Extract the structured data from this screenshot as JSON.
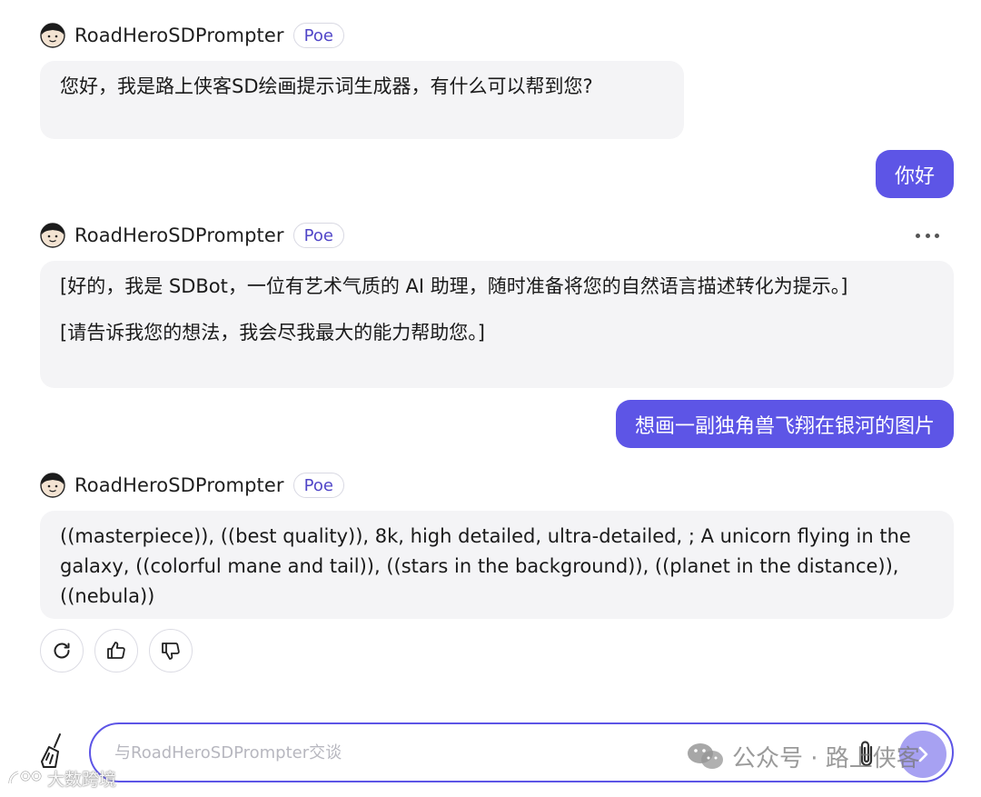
{
  "bot": {
    "name": "RoadHeroSDPrompter",
    "badge": "Poe"
  },
  "messages": {
    "m1": {
      "text": "您好，我是路上侠客SD绘画提示词生成器，有什么可以帮到您?"
    },
    "u1": {
      "text": "你好"
    },
    "m2": {
      "p1": "[好的，我是 SDBot，一位有艺术气质的 AI 助理，随时准备将您的自然语言描述转化为提示。]",
      "p2": "[请告诉我您的想法，我会尽我最大的能力帮助您。]"
    },
    "u2": {
      "text": "想画一副独角兽飞翔在银河的图片"
    },
    "m3": {
      "text": "((masterpiece)), ((best quality)), 8k, high detailed, ultra-detailed, ; A unicorn flying in the galaxy, ((colorful mane and tail)), ((stars in the background)), ((planet in the distance)), ((nebula))"
    }
  },
  "composer": {
    "placeholder": "与RoadHeroSDPrompter交谈"
  },
  "watermark": {
    "right": "公众号 · 路上侠客",
    "left": "大数跨境"
  },
  "colors": {
    "accent": "#5d55e6",
    "bubble_bot": "#f4f4f6",
    "badge_text": "#5146c8"
  }
}
